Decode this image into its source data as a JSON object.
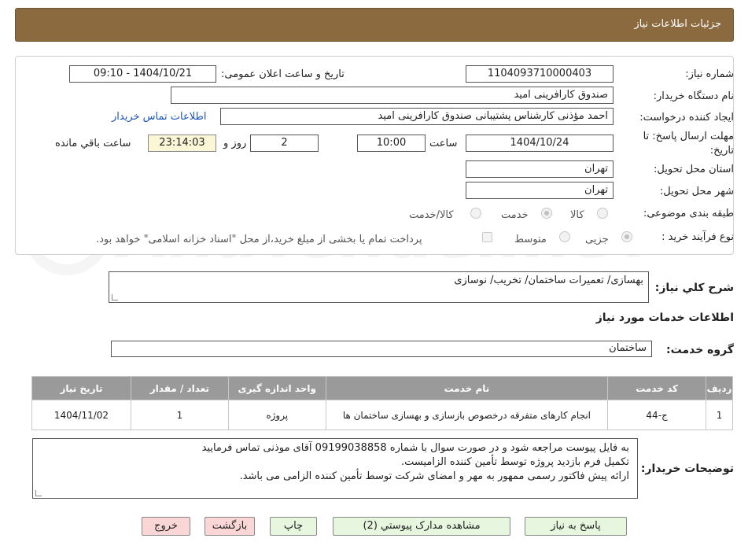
{
  "header": {
    "title": "جزئیات اطلاعات نیاز"
  },
  "watermark": {
    "text": "AnaTender.neT"
  },
  "form": {
    "need_number_label": "شماره نیاز:",
    "need_number": "1104093710000403",
    "announce_label": "تاریخ و ساعت اعلان عمومی:",
    "announce_value": "1404/10/21 - 09:10",
    "buyer_org_label": "نام دستگاه خریدار:",
    "buyer_org": "صندوق کارافرینی امید",
    "requester_label": "ایجاد کننده درخواست:",
    "requester": "احمد مؤذنی کارشناس پشتیبانی صندوق کارافرینی امید",
    "contact_link": "اطلاعات تماس خریدار",
    "deadline_label_1": "مهلت ارسال پاسخ: تا",
    "deadline_label_2": "تاریخ:",
    "deadline_date": "1404/10/24",
    "time_label": "ساعت",
    "deadline_time": "10:00",
    "days_value": "2",
    "days_label": "روز و",
    "countdown": "23:14:03",
    "remaining_label": "ساعت باقي مانده",
    "province_label": "استان محل تحویل:",
    "province": "تهران",
    "city_label": "شهر محل تحویل:",
    "city": "تهران",
    "category_label": "طبقه بندی موضوعی:",
    "category_options": [
      "کالا",
      "خدمت",
      "کالا/خدمت"
    ],
    "purchase_type_label": "نوع فرآیند خرید :",
    "purchase_options": [
      "جزیی",
      "متوسط"
    ],
    "payment_note": "پرداخت تمام یا بخشی از مبلغ خرید،از محل \"اسناد خزانه اسلامی\" خواهد بود."
  },
  "summary": {
    "label": "شرح کلي نیاز:",
    "value": "بهسازی/ تعمیرات ساختمان/ تخریب/ نوسازی"
  },
  "services": {
    "section_title": "اطلاعات خدمات مورد نیاز",
    "group_label": "گروه خدمت:",
    "group_value": "ساختمان",
    "columns": [
      "ردیف",
      "کد خدمت",
      "نام خدمت",
      "واحد اندازه گیری",
      "تعداد / مقدار",
      "تاریخ نیاز"
    ],
    "rows": [
      [
        "1",
        "ج-44",
        "انجام کارهای متفرقه درخصوص بازسازی و بهسازی ساختمان ها",
        "پروژه",
        "1",
        "1404/11/02"
      ]
    ]
  },
  "notes": {
    "label": "توضیحات خریدار:",
    "lines": [
      "به فایل پیوست مراجعه شود و در صورت سوال با شماره 09199038858 آقای موذنی تماس  فرمایید",
      "تکمیل فرم بازدید پروژه توسط تأمین کننده الزامیست.",
      "ارائه پیش فاکتور رسمی ممهور به مهر و امضای شرکت توسط تأمین کننده الزامی می باشد."
    ]
  },
  "buttons": {
    "reply": "پاسخ به نیاز",
    "attachments": "مشاهده مدارک پیوستي (2)",
    "print": "چاپ",
    "back": "بازگشت",
    "exit": "خروج"
  },
  "colors": {
    "header_bg": "#8b6a3f",
    "table_header_bg": "#9a9a9a",
    "countdown_bg": "#fbf6d5",
    "green_btn": "#e7f7df",
    "red_btn": "#fbd6d6"
  }
}
